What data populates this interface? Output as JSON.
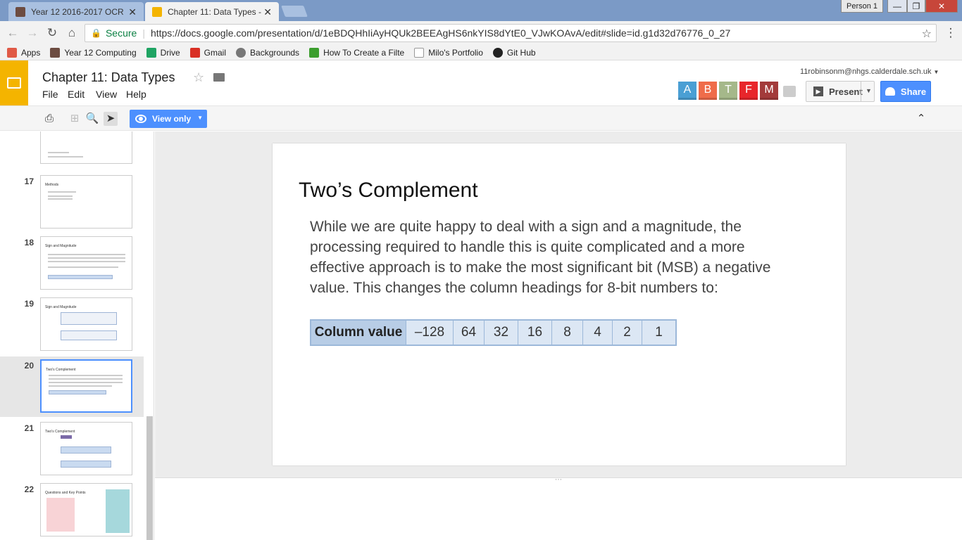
{
  "browser": {
    "tabs": [
      {
        "title": "Year 12 2016-2017 OCR",
        "active": false
      },
      {
        "title": "Chapter 11: Data Types -",
        "active": true
      }
    ],
    "profile": "Person 1",
    "window_buttons": {
      "minimize": "—",
      "maximize": "❐",
      "close": "✕"
    },
    "nav": {
      "back": "←",
      "forward": "→",
      "reload": "↻",
      "home": "⌂"
    },
    "security_label": "Secure",
    "url": "https://docs.google.com/presentation/d/1eBDQHhIiAyHQUk2BEEAgHS6nkYIS8dYtE0_VJwKOAvA/edit#slide=id.g1d32d76776_0_27",
    "bookmarks": [
      {
        "label": "Apps",
        "icon": "apps-grid-icon",
        "color": "#e05a47"
      },
      {
        "label": "Year 12 Computing",
        "icon": "profile-icon",
        "color": "#6d4c41"
      },
      {
        "label": "Drive",
        "icon": "drive-icon",
        "color": "#1fa463"
      },
      {
        "label": "Gmail",
        "icon": "gmail-icon",
        "color": "#d93025"
      },
      {
        "label": "Backgrounds",
        "icon": "backgrounds-icon",
        "color": "#777777"
      },
      {
        "label": "How To Create a Filte",
        "icon": "filter-icon",
        "color": "#3c9e2e"
      },
      {
        "label": "Milo's Portfolio",
        "icon": "page-icon",
        "color": "#999999"
      },
      {
        "label": "Git Hub",
        "icon": "github-icon",
        "color": "#222222"
      }
    ]
  },
  "docs": {
    "title": "Chapter 11:  Data Types",
    "menu": [
      "File",
      "Edit",
      "View",
      "Help"
    ],
    "account": "11robinsonm@nhgs.calderdale.sch.uk",
    "collaborators": [
      {
        "letter": "A",
        "color": "#4a9fd4"
      },
      {
        "letter": "B",
        "color": "#ef6c4a"
      },
      {
        "letter": "T",
        "color": "#a5b88a"
      },
      {
        "letter": "F",
        "color": "#e8262b"
      },
      {
        "letter": "M",
        "color": "#a33a3a"
      }
    ],
    "present_label": "Present",
    "share_label": "Share",
    "view_only_label": "View only",
    "accent": "#4d90fe",
    "brand": "#f4b400"
  },
  "filmstrip": [
    {
      "number": "",
      "title": "",
      "selected": false
    },
    {
      "number": "17",
      "title": "Methods",
      "selected": false
    },
    {
      "number": "18",
      "title": "Sign and Magnitude",
      "selected": false
    },
    {
      "number": "19",
      "title": "Sign and Magnitude",
      "selected": false
    },
    {
      "number": "20",
      "title": "Two's Complement",
      "selected": true
    },
    {
      "number": "21",
      "title": "Two's Complement",
      "selected": false
    },
    {
      "number": "22",
      "title": "Questions and Key Points",
      "selected": false
    }
  ],
  "slide": {
    "title": "Two’s Complement",
    "body": "While we are quite happy to deal with a sign and a magnitude, the processing required to handle this is quite complicated and a more effective approach is to make the most significant bit (MSB) a negative value. This changes the column headings for 8-bit numbers to:",
    "table": {
      "header": "Column value",
      "values": [
        "–128",
        "64",
        "32",
        "16",
        "8",
        "4",
        "2",
        "1"
      ]
    }
  },
  "notes_divider": "⋯"
}
